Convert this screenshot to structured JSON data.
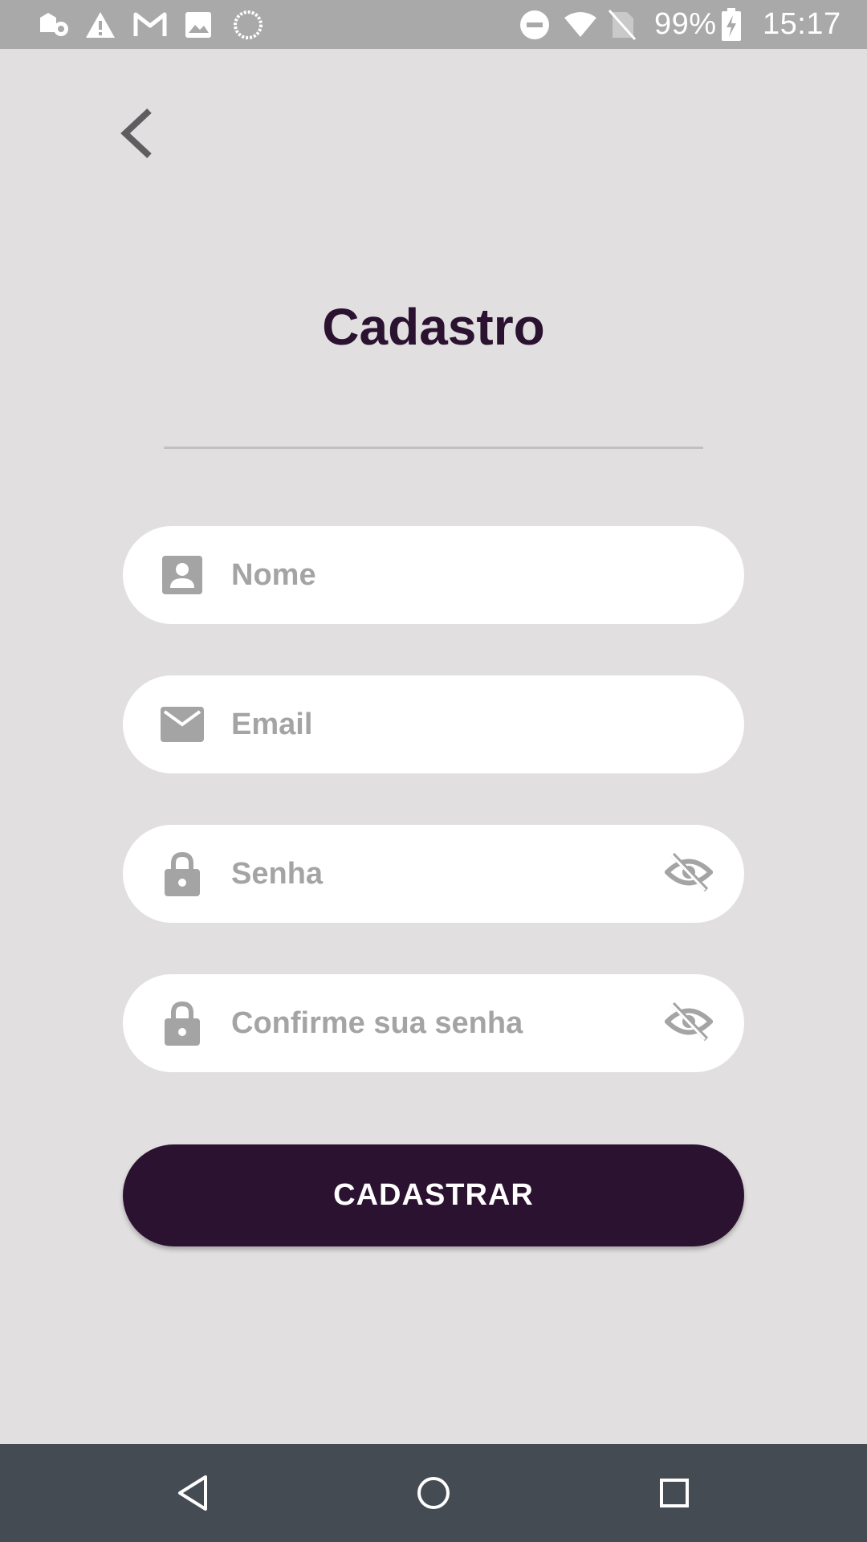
{
  "status_bar": {
    "battery_text": "99%",
    "time": "15:17",
    "icons": [
      "app-notification-icon",
      "warning-icon",
      "gmail-icon",
      "image-icon",
      "sync-icon",
      "do-not-disturb-icon",
      "wifi-icon",
      "no-sim-icon",
      "battery-charging-icon"
    ]
  },
  "header": {
    "back_icon": "chevron-left-icon",
    "title": "Cadastro"
  },
  "form": {
    "name": {
      "placeholder": "Nome",
      "icon": "contact-icon"
    },
    "email": {
      "placeholder": "Email",
      "icon": "mail-icon"
    },
    "password": {
      "placeholder": "Senha",
      "icon": "lock-icon",
      "toggle_icon": "eye-off-icon"
    },
    "confirm_password": {
      "placeholder": "Confirme sua senha",
      "icon": "lock-icon",
      "toggle_icon": "eye-off-icon"
    },
    "submit_label": "CADASTRAR"
  },
  "nav_bar": {
    "icons": [
      "nav-back-icon",
      "nav-home-icon",
      "nav-recents-icon"
    ]
  },
  "colors": {
    "background": "#e1dfe0",
    "primary": "#2a1230",
    "placeholder": "#a4a4a4",
    "status_bar": "#a9a9a9",
    "nav_bar": "#444b52"
  }
}
